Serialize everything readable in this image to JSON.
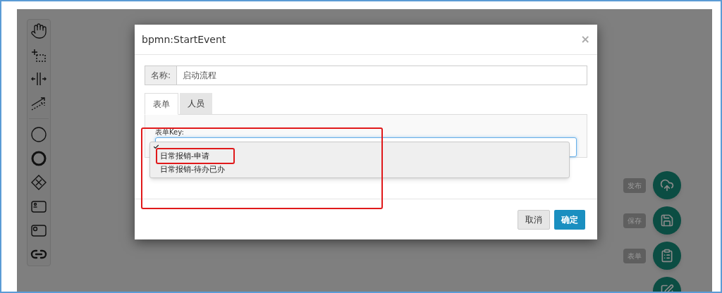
{
  "toolbar": [
    {
      "kind": "hand"
    },
    {
      "kind": "lasso"
    },
    {
      "kind": "space"
    },
    {
      "kind": "connect"
    },
    {
      "kind": "divider"
    },
    {
      "kind": "start"
    },
    {
      "kind": "end"
    },
    {
      "kind": "gateway"
    },
    {
      "kind": "user-task"
    },
    {
      "kind": "service-task"
    },
    {
      "kind": "link"
    }
  ],
  "fabs": [
    {
      "label": "发布",
      "kind": "upload"
    },
    {
      "label": "保存",
      "kind": "save"
    },
    {
      "label": "表单",
      "kind": "form"
    },
    {
      "kind": "edit"
    }
  ],
  "dialog": {
    "title": "bpmn:StartEvent",
    "close": "×",
    "name_field": {
      "label": "名称:",
      "value": "启动流程"
    },
    "tabs": [
      {
        "label": "表单",
        "selected": true
      },
      {
        "label": "人员",
        "selected": false
      }
    ],
    "form_key": {
      "label": "表单Key:",
      "blank_option_selected": true,
      "options": [
        {
          "label": "日常报销-申请",
          "selected": false
        },
        {
          "label": "日常报销-待办已办",
          "selected": false
        }
      ]
    },
    "buttons": [
      {
        "label": "取消",
        "kind": "default"
      },
      {
        "label": "确定",
        "kind": "primary"
      }
    ]
  }
}
